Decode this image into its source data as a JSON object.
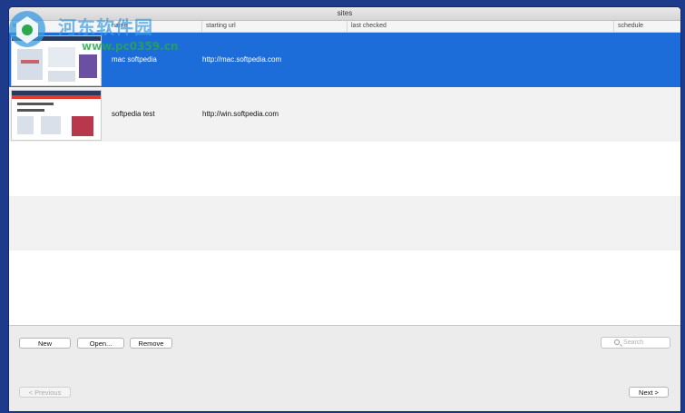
{
  "window": {
    "title": "sites"
  },
  "table": {
    "columns": [
      "image",
      "name",
      "starting url",
      "last checked",
      "schedule"
    ],
    "rows": [
      {
        "name": "mac softpedia",
        "url": "http://mac.softpedia.com",
        "last_checked": "",
        "schedule": "",
        "selected": true
      },
      {
        "name": "softpedia test",
        "url": "http://win.softpedia.com",
        "last_checked": "",
        "schedule": "",
        "selected": false
      }
    ]
  },
  "toolbar": {
    "new_label": "New",
    "open_label": "Open...",
    "remove_label": "Remove",
    "search_placeholder": "Search"
  },
  "pager": {
    "previous_label": "< Previous",
    "next_label": "Next >"
  },
  "watermark": {
    "text": "河东软件园",
    "sub": "www.pc0359.cn"
  },
  "colors": {
    "selection": "#1c6cd9",
    "desktop": "#1e3a8a"
  }
}
